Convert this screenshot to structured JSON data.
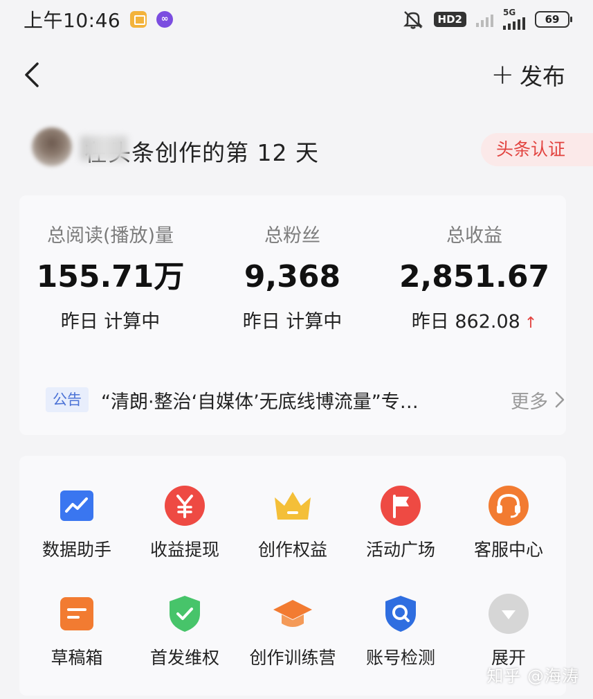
{
  "status_bar": {
    "time": "上午10:46",
    "hd_label": "HD2",
    "net_label": "5G",
    "battery": "69",
    "app_icon2_label": "∞"
  },
  "nav": {
    "publish_label": "发布"
  },
  "creator": {
    "days_text": "在头条创作的第 12 天",
    "verify_label": "头条认证"
  },
  "stats": [
    {
      "label": "总阅读(播放)量",
      "value": "155.71万",
      "sub": "昨日 计算中"
    },
    {
      "label": "总粉丝",
      "value": "9,368",
      "sub": "昨日 计算中"
    },
    {
      "label": "总收益",
      "value": "2,851.67",
      "sub": "昨日 862.08",
      "sub_trend": "↑"
    }
  ],
  "notice": {
    "tag": "公告",
    "text": "“清朗·整治‘自媒体’无底线博流量”专…",
    "more": "更多"
  },
  "tools": [
    {
      "label": "数据助手",
      "icon": "chart-icon",
      "color": "#3a76f0"
    },
    {
      "label": "收益提现",
      "icon": "yuan-icon",
      "color": "#ee4a43"
    },
    {
      "label": "创作权益",
      "icon": "crown-icon",
      "color": "#f4bf38"
    },
    {
      "label": "活动广场",
      "icon": "flag-icon",
      "color": "#ee4a43"
    },
    {
      "label": "客服中心",
      "icon": "headset-icon",
      "color": "#f27b31"
    },
    {
      "label": "草稿箱",
      "icon": "draft-icon",
      "color": "#f27b31"
    },
    {
      "label": "首发维权",
      "icon": "shield-check-icon",
      "color": "#47c46a"
    },
    {
      "label": "创作训练营",
      "icon": "graduation-cap-icon",
      "color": "#f27b31"
    },
    {
      "label": "账号检测",
      "icon": "shield-search-icon",
      "color": "#2f6ee0"
    },
    {
      "label": "展开",
      "icon": "expand-icon",
      "color": "#d6d6d6"
    }
  ],
  "watermark": "知乎 @海涛"
}
